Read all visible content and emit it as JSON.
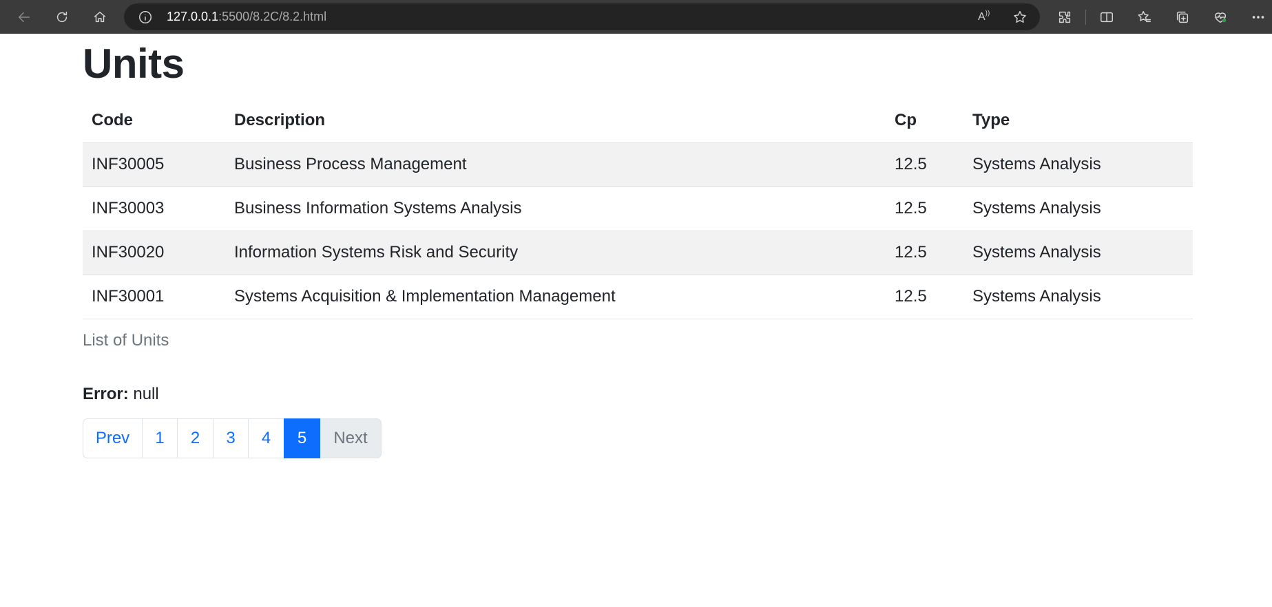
{
  "browser": {
    "url_host": "127.0.0.1",
    "url_path": ":5500/8.2C/8.2.html",
    "read_aloud_glyph": "A"
  },
  "page": {
    "title": "Units",
    "table": {
      "headers": [
        "Code",
        "Description",
        "Cp",
        "Type"
      ],
      "rows": [
        {
          "code": "INF30005",
          "description": "Business Process Management",
          "cp": "12.5",
          "type": "Systems Analysis"
        },
        {
          "code": "INF30003",
          "description": "Business Information Systems Analysis",
          "cp": "12.5",
          "type": "Systems Analysis"
        },
        {
          "code": "INF30020",
          "description": "Information Systems Risk and Security",
          "cp": "12.5",
          "type": "Systems Analysis"
        },
        {
          "code": "INF30001",
          "description": "Systems Acquisition & Implementation Management",
          "cp": "12.5",
          "type": "Systems Analysis"
        }
      ],
      "caption": "List of Units"
    },
    "error": {
      "label": "Error:",
      "value": "null"
    },
    "pagination": {
      "prev": "Prev",
      "pages": [
        "1",
        "2",
        "3",
        "4",
        "5"
      ],
      "active": "5",
      "next": "Next"
    }
  },
  "colors": {
    "primary": "#0d6efd",
    "striped_row": "#f2f2f2",
    "chrome_bg": "#3b3b3b",
    "address_bg": "#232323"
  }
}
